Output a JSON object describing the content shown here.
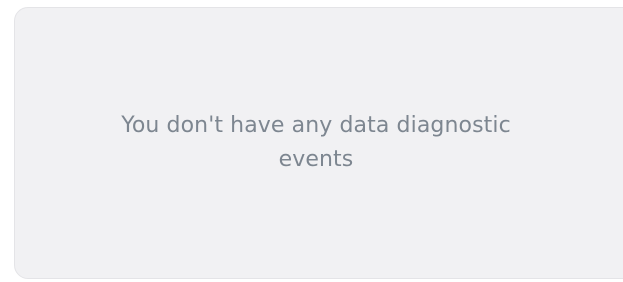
{
  "empty_state": {
    "message": "You don't have any data diagnostic events"
  },
  "colors": {
    "panel_background": "#f1f1f3",
    "panel_border": "#e4e4e7",
    "message_text": "#7d8690"
  }
}
